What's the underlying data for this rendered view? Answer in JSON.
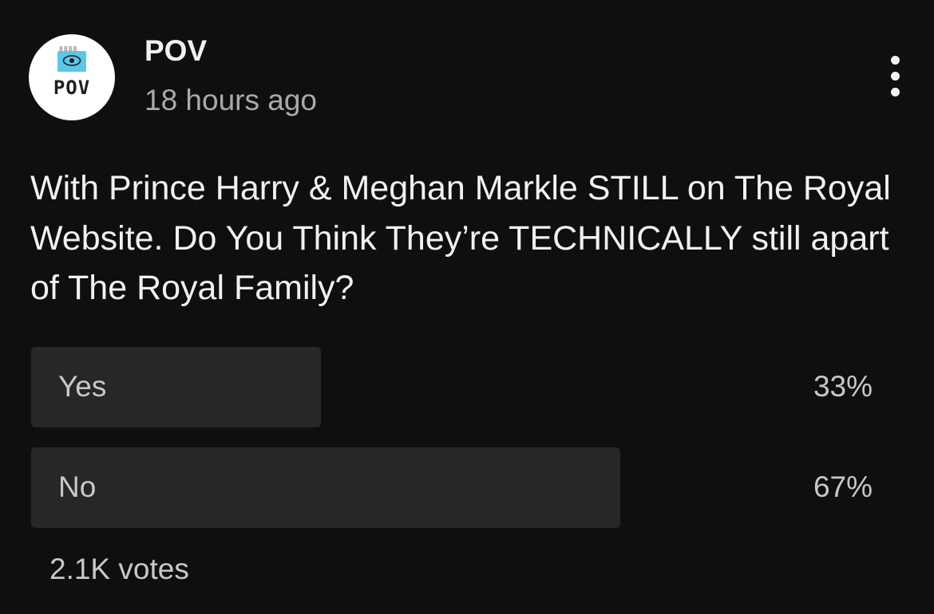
{
  "channel": {
    "name": "POV",
    "timestamp": "18 hours ago",
    "avatar": {
      "logo_text": "POV",
      "binder_text": "8888",
      "icon": "eye-icon",
      "accent_color": "#5cc6e8"
    }
  },
  "menu": {
    "icon": "more-vertical-icon"
  },
  "post": {
    "question": "With Prince Harry & Meghan Markle STILL on The Royal Website. Do You Think They’re TECHNICALLY still apart of The Royal Family?"
  },
  "poll": {
    "options": [
      {
        "label": "Yes",
        "percent_text": "33%",
        "fraction": 0.33
      },
      {
        "label": "No",
        "percent_text": "67%",
        "fraction": 0.67
      }
    ],
    "votes": "2.1K votes"
  },
  "colors": {
    "background": "#0f0f0f",
    "text_primary": "#f1f1f1",
    "text_secondary": "#aaaaaa",
    "poll_fill": "#272727"
  }
}
